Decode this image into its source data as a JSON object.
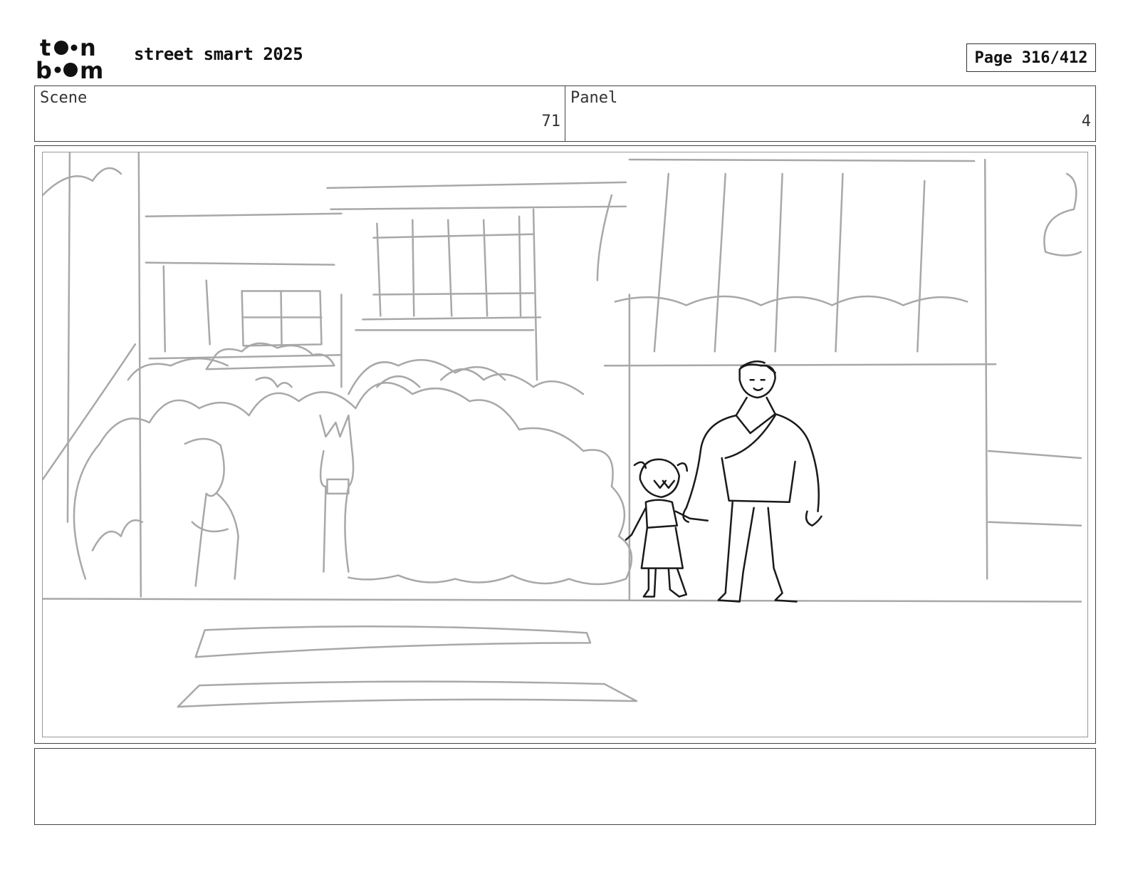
{
  "header": {
    "logo_text": "toon boom",
    "project_title": "street smart 2025",
    "page_label": "Page 316/412"
  },
  "info": {
    "scene_label": "Scene",
    "scene_value": "71",
    "panel_label": "Panel",
    "panel_value": "4"
  },
  "notes": {
    "text": ""
  }
}
